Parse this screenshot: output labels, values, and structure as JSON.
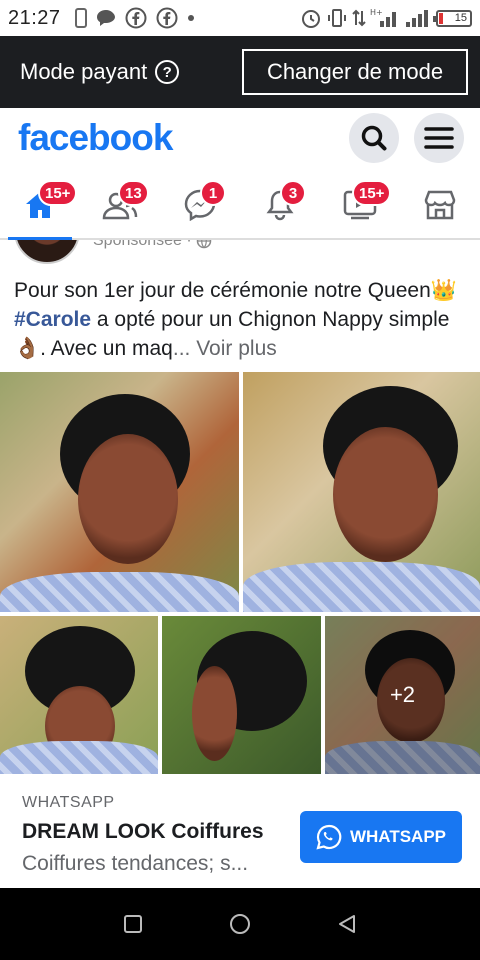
{
  "status_bar": {
    "time": "21:27",
    "battery_level": "15"
  },
  "mode_bar": {
    "label": "Mode payant",
    "help_icon_text": "?",
    "change_button": "Changer de mode"
  },
  "header": {
    "logo": "facebook",
    "brand_color": "#1877f2"
  },
  "nav_tabs": [
    {
      "name": "home",
      "badge": "15+",
      "active": true
    },
    {
      "name": "friends",
      "badge": "13"
    },
    {
      "name": "messenger",
      "badge": "1"
    },
    {
      "name": "notifications",
      "badge": "3"
    },
    {
      "name": "watch",
      "badge": "15+"
    },
    {
      "name": "marketplace",
      "badge": ""
    }
  ],
  "post": {
    "sponsored_label": "Sponsorisée",
    "sponsored_dot": "·",
    "text_part1": "Pour son 1er jour de cérémonie notre Queen",
    "crown_emoji": "👑",
    "hashtag": "#Carole",
    "text_part2": " a opté pour un Chignon Nappy simple ",
    "ok_emoji": "👌🏾",
    "text_part3": ". Avec un maq",
    "see_more": "... Voir plus",
    "more_photos": "+2"
  },
  "cta": {
    "source": "WHATSAPP",
    "title": "DREAM LOOK Coiffures",
    "subtitle": "Coiffures tendances; s...",
    "button": "WHATSAPP"
  }
}
